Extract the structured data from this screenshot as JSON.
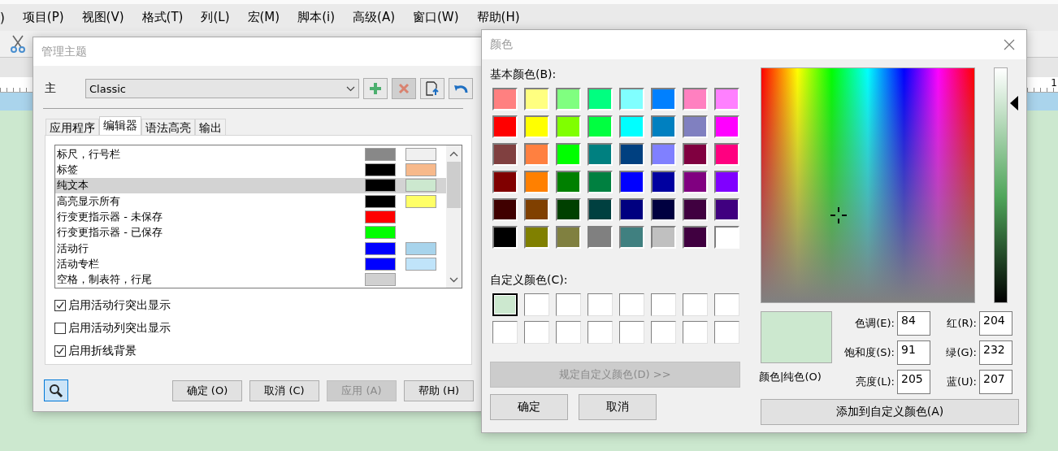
{
  "app": {
    "menu": [
      ")",
      "项目(P)",
      "视图(V)",
      "格式(T)",
      "列(L)",
      "宏(M)",
      "脚本(i)",
      "高级(A)",
      "窗口(W)",
      "帮助(H)"
    ],
    "ruler_label": "1"
  },
  "theme_dialog": {
    "title": "管理主题",
    "theme_label": "主",
    "theme": "Classic",
    "tool_buttons": [
      {
        "kind": "add",
        "disabled": false
      },
      {
        "kind": "delete",
        "disabled": true
      },
      {
        "kind": "export",
        "disabled": false
      },
      {
        "kind": "undo",
        "disabled": false
      }
    ],
    "tabs": [
      {
        "label": "应用程序",
        "selected": false
      },
      {
        "label": "编辑器",
        "selected": true
      },
      {
        "label": "语法高亮",
        "selected": false
      },
      {
        "label": "输出",
        "selected": false
      }
    ],
    "items": [
      {
        "label": "标尺，行号栏",
        "selected": false,
        "swatches": [
          {
            "color": "#888888"
          },
          {
            "color": "#f0f0f0"
          }
        ]
      },
      {
        "label": "标签",
        "selected": false,
        "swatches": [
          {
            "color": "#000000"
          },
          {
            "color": "#f7b98b"
          }
        ]
      },
      {
        "label": "纯文本",
        "selected": true,
        "swatches": [
          {
            "color": "#000000"
          },
          {
            "color": "#cce8cf"
          }
        ]
      },
      {
        "label": "高亮显示所有",
        "selected": false,
        "swatches": [
          {
            "color": "#000000"
          },
          {
            "color": "#ffff66"
          }
        ]
      },
      {
        "label": "行变更指示器 - 未保存",
        "selected": false,
        "swatches": [
          {
            "color": "#ff0000"
          }
        ]
      },
      {
        "label": "行变更指示器 - 已保存",
        "selected": false,
        "swatches": [
          {
            "color": "#00ff00"
          }
        ]
      },
      {
        "label": "活动行",
        "selected": false,
        "swatches": [
          {
            "color": "#0000ff"
          },
          {
            "color": "#a8d4ec"
          }
        ]
      },
      {
        "label": "活动专栏",
        "selected": false,
        "swatches": [
          {
            "color": "#0000ff"
          },
          {
            "color": "#c0e4fa"
          }
        ]
      },
      {
        "label": "空格，制表符，行尾",
        "selected": false,
        "swatches": [
          {
            "color": "#d0d0d0"
          }
        ]
      }
    ],
    "options": [
      {
        "label": "启用活动行突出显示",
        "checked": true
      },
      {
        "label": "启用活动列突出显示",
        "checked": false
      },
      {
        "label": "启用折线背景",
        "checked": true
      }
    ],
    "buttons": [
      {
        "label": "确定 (O)",
        "disabled": false
      },
      {
        "label": "取消 (C)",
        "disabled": false
      },
      {
        "label": "应用 (A)",
        "disabled": true
      },
      {
        "label": "帮助 (H)",
        "disabled": false
      }
    ]
  },
  "color_dialog": {
    "title": "颜色",
    "basic_label": "基本颜色(B):",
    "basic_colors": [
      {
        "color": "#ff8080"
      },
      {
        "color": "#ffff80"
      },
      {
        "color": "#80ff80"
      },
      {
        "color": "#00ff80"
      },
      {
        "color": "#80ffff"
      },
      {
        "color": "#0080ff"
      },
      {
        "color": "#ff80c0"
      },
      {
        "color": "#ff80ff"
      },
      {
        "color": "#ff0000"
      },
      {
        "color": "#ffff00"
      },
      {
        "color": "#80ff00"
      },
      {
        "color": "#00ff40"
      },
      {
        "color": "#00ffff"
      },
      {
        "color": "#0080c0"
      },
      {
        "color": "#8080c0"
      },
      {
        "color": "#ff00ff"
      },
      {
        "color": "#804040"
      },
      {
        "color": "#ff8040"
      },
      {
        "color": "#00ff00"
      },
      {
        "color": "#008080"
      },
      {
        "color": "#004080"
      },
      {
        "color": "#8080ff"
      },
      {
        "color": "#800040"
      },
      {
        "color": "#ff0080"
      },
      {
        "color": "#800000"
      },
      {
        "color": "#ff8000"
      },
      {
        "color": "#008000"
      },
      {
        "color": "#008040"
      },
      {
        "color": "#0000ff"
      },
      {
        "color": "#0000a0"
      },
      {
        "color": "#800080"
      },
      {
        "color": "#8000ff"
      },
      {
        "color": "#400000"
      },
      {
        "color": "#804000"
      },
      {
        "color": "#004000"
      },
      {
        "color": "#004040"
      },
      {
        "color": "#000080"
      },
      {
        "color": "#000040"
      },
      {
        "color": "#400040"
      },
      {
        "color": "#400080"
      },
      {
        "color": "#000000"
      },
      {
        "color": "#808000"
      },
      {
        "color": "#808040"
      },
      {
        "color": "#808080"
      },
      {
        "color": "#408080"
      },
      {
        "color": "#c0c0c0"
      },
      {
        "color": "#400040"
      },
      {
        "color": "#ffffff"
      }
    ],
    "custom_label": "自定义颜色(C):",
    "custom_colors": [
      {
        "color": "#cce8cf",
        "selected": true
      },
      {
        "color": "#ffffff",
        "selected": false
      },
      {
        "color": "#ffffff",
        "selected": false
      },
      {
        "color": "#ffffff",
        "selected": false
      },
      {
        "color": "#ffffff",
        "selected": false
      },
      {
        "color": "#ffffff",
        "selected": false
      },
      {
        "color": "#ffffff",
        "selected": false
      },
      {
        "color": "#ffffff",
        "selected": false
      },
      {
        "color": "#ffffff",
        "selected": false
      },
      {
        "color": "#ffffff",
        "selected": false
      },
      {
        "color": "#ffffff",
        "selected": false
      },
      {
        "color": "#ffffff",
        "selected": false
      },
      {
        "color": "#ffffff",
        "selected": false
      },
      {
        "color": "#ffffff",
        "selected": false
      },
      {
        "color": "#ffffff",
        "selected": false
      },
      {
        "color": "#ffffff",
        "selected": false
      }
    ],
    "define_button": {
      "label": "规定自定义颜色(D) >>",
      "disabled": true
    },
    "buttons": [
      "确定",
      "取消"
    ],
    "luminance": {
      "level": 0.85
    },
    "preview": {
      "color": "#cce8cf"
    },
    "preview_label": "颜色|纯色(O)",
    "fields": [
      {
        "label": "色调(E):",
        "value": "84"
      },
      {
        "label": "红(R):",
        "value": "204"
      },
      {
        "label": "饱和度(S):",
        "value": "91"
      },
      {
        "label": "绿(G):",
        "value": "232"
      },
      {
        "label": "亮度(L):",
        "value": "205"
      },
      {
        "label": "蓝(U):",
        "value": "207"
      }
    ],
    "add_button": "添加到自定义颜色(A)"
  }
}
